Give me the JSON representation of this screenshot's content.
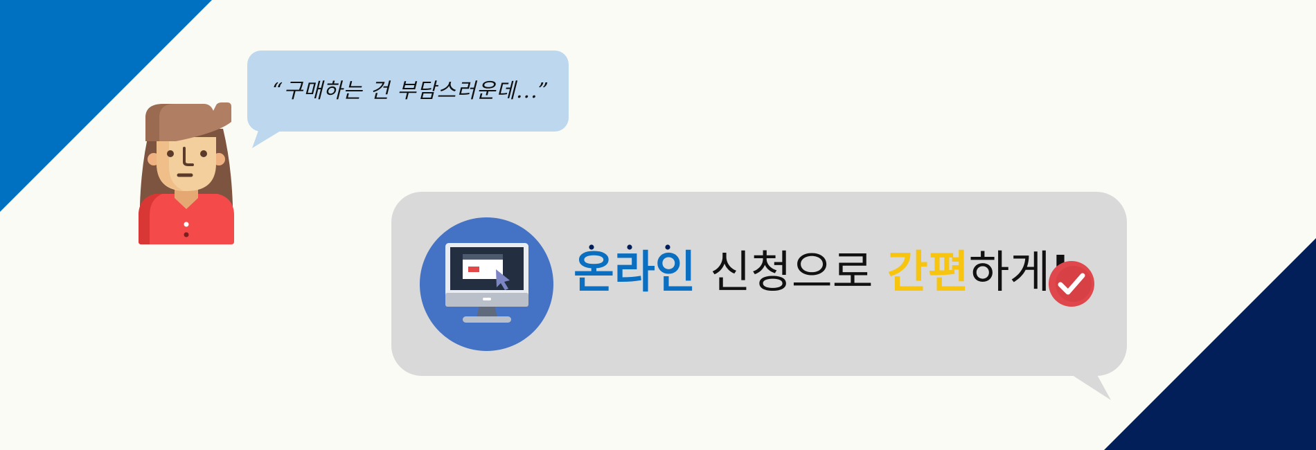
{
  "thought_bubble": {
    "text": "“구매하는 건 부담스러운데...”"
  },
  "headline": {
    "part_blue": "온라인",
    "part_plain_1": " 신청으로 ",
    "part_yellow": "간편",
    "part_plain_2": "하게",
    "part_exclaim": "!"
  },
  "colors": {
    "background": "#fbfbf5",
    "corner_top_left": "#0071c1",
    "corner_bottom_right": "#021f5a",
    "small_bubble": "#bdd7ee",
    "big_bubble": "#d9d9d9",
    "monitor_circle": "#4472c4",
    "highlight_blue": "#0a6fc0",
    "highlight_yellow": "#f7c50f",
    "check_red": "#e0474c"
  },
  "icons": {
    "avatar": "woman-avatar-icon",
    "monitor": "computer-monitor-icon",
    "check": "check-badge-icon"
  }
}
